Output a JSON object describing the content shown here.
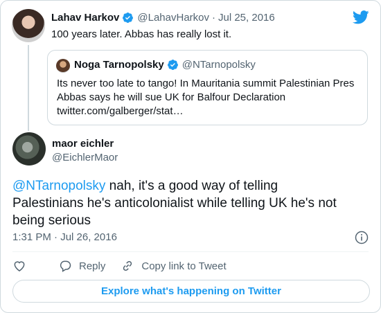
{
  "parent_tweet": {
    "name": "Lahav Harkov",
    "handle": "@LahavHarkov",
    "separator": "·",
    "date": "Jul 25, 2016",
    "text": "100 years later. Abbas has really lost it."
  },
  "quoted_tweet": {
    "name": "Noga Tarnopolsky",
    "handle": "@NTarnopolsky",
    "line1": "Its never too late to tango! In Mauritania summit Palestinian Pres",
    "line2": "Abbas says he will sue UK for Balfour Declaration",
    "line3": "twitter.com/galberger/stat…"
  },
  "main_tweet": {
    "name": "maor eichler",
    "handle": "@EichlerMaor",
    "mention": "@NTarnopolsky",
    "text_part1": " nah, it's a good way of telling",
    "text_line2": "Palestinians he's anticolonialist while telling UK he's not",
    "text_line3": "being serious",
    "timestamp": "1:31 PM · Jul 26, 2016"
  },
  "actions": {
    "reply_label": "Reply",
    "copy_label": "Copy link to Tweet"
  },
  "explore_label": "Explore what's happening on Twitter",
  "colors": {
    "accent": "#1d9bf0",
    "muted": "#536471",
    "border": "#cfd9de"
  },
  "icons": [
    "twitter-bird-icon",
    "verified-badge-icon",
    "info-icon",
    "heart-icon",
    "reply-icon",
    "link-icon"
  ]
}
